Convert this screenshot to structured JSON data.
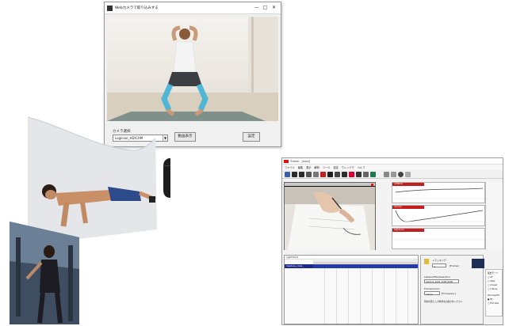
{
  "capture_dialog": {
    "title": "Webカメラで取り込みする",
    "camera_label": "カメラ選択",
    "camera_selected": "Logicool_HD(CAM",
    "preview_button": "動画表示",
    "ok_button": "設定",
    "window_controls": {
      "minimize": "—",
      "maximize": "□",
      "close": "✕"
    }
  },
  "analysis_app": {
    "title": "Tracker  - [main]",
    "menu": [
      "ファイル",
      "編集",
      "表示",
      "解析",
      "ツール",
      "設定",
      "ウィンドウ",
      "ヘルプ"
    ],
    "graphs": [
      {
        "label": "LeftWrist",
        "color": "#c51d1d"
      },
      {
        "label": "Velocity",
        "color": "#c51d1d"
      },
      {
        "label": "HighScore",
        "color": "#c51d1d"
      }
    ],
    "axis_ticks": [
      "0.00",
      "2.00",
      "4.00",
      "6.00",
      "8.00"
    ],
    "timeline": {
      "title": "LightTrack",
      "track_name": "Capture_clip1_"
    },
    "props": {
      "count_label": "トラッキング",
      "count_value": "1",
      "count_unit": "[Frame]",
      "file_label": "Labeled/File/Selection",
      "file_value": "Capture_2018_2108_0008",
      "frame_label": "Frame/Count",
      "frame_value": "13:12",
      "frame_unit": "[Frame/sec]",
      "note": "現在位置と入力時刻をお確かめください"
    },
    "radio": {
      "group1_title": "検出モード",
      "group1_options": [
        "AF",
        "Step",
        "Closed",
        "Infinity"
      ],
      "group2_title": "Window/Fit",
      "group2_options": [
        "Fit",
        "Full Size"
      ]
    }
  }
}
